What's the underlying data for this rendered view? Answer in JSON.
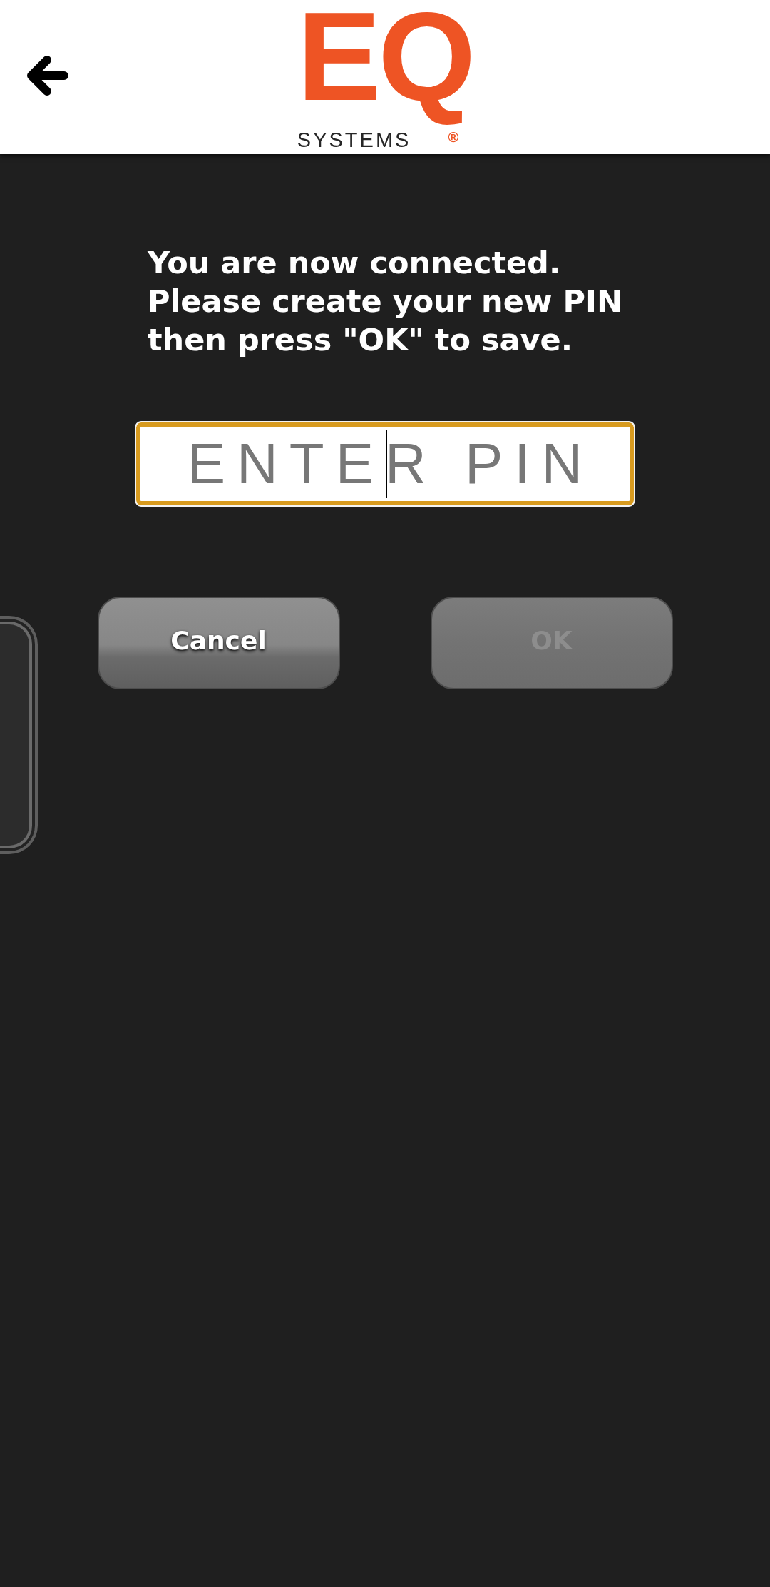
{
  "header": {
    "logo": {
      "letters": "EQ",
      "subtitle": "SYSTEMS",
      "registered_mark": "®"
    }
  },
  "message": "You are now connected.\nPlease create your new PIN\nthen press \"OK\" to save.",
  "pin_field": {
    "placeholder": "ENTER PIN",
    "focused": true
  },
  "buttons": [
    {
      "label": "Cancel",
      "disabled": false
    },
    {
      "label": "OK",
      "disabled": true
    }
  ]
}
